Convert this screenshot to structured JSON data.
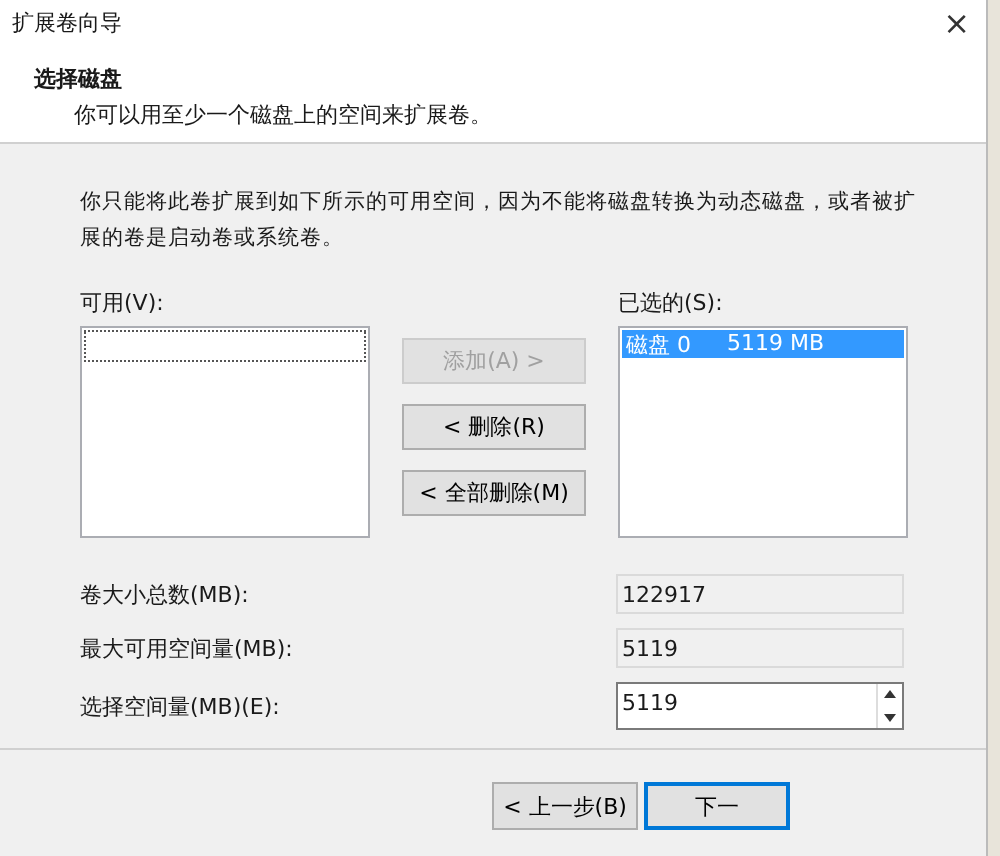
{
  "window": {
    "title": "扩展卷向导",
    "close": "×"
  },
  "header": {
    "title": "选择磁盘",
    "subtitle": "你可以用至少一个磁盘上的空间来扩展卷。"
  },
  "description": "你只能将此卷扩展到如下所示的可用空间，因为不能将磁盘转换为动态磁盘，或者被扩展的卷是启动卷或系统卷。",
  "available": {
    "label": "可用(V):"
  },
  "selected_list": {
    "label": "已选的(S):",
    "items": [
      {
        "disk": "磁盘 0",
        "size": "5119 MB",
        "selected": true
      }
    ]
  },
  "transfer_buttons": [
    {
      "label": "添加(A) >",
      "disabled": true
    },
    {
      "label": "< 删除(R)",
      "disabled": false
    },
    {
      "label": "< 全部删除(M)",
      "disabled": false
    }
  ],
  "fields": [
    {
      "kind": "readonly",
      "label": "卷大小总数(MB):",
      "value": "122917"
    },
    {
      "kind": "readonly",
      "label": "最大可用空间量(MB):",
      "value": "5119"
    },
    {
      "kind": "spinner",
      "label": "选择空间量(MB)(E):",
      "value": "5119"
    }
  ],
  "footer_buttons": [
    {
      "label": "< 上一步(B)",
      "focused": false
    },
    {
      "label": "下一",
      "focused": true
    }
  ]
}
